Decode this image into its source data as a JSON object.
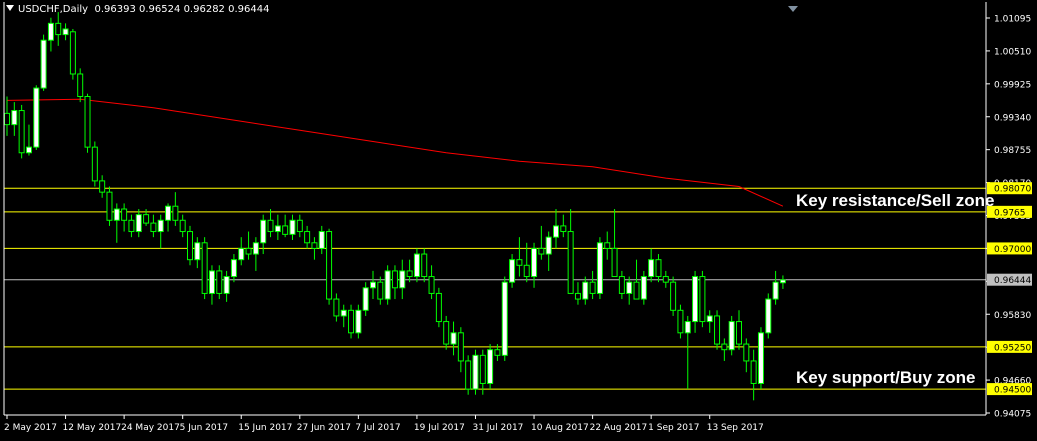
{
  "header": {
    "symbol_timeframe": "USDCHF,Daily",
    "open": "0.96393",
    "high": "0.96524",
    "low": "0.96282",
    "close": "0.96444"
  },
  "annotations": {
    "resistance": "Key resistance/Sell zone",
    "support": "Key support/Buy zone"
  },
  "colors": {
    "background": "#000000",
    "bull_candle": "#ffffff",
    "bear_candle": "#000000",
    "wick": "#00ff00",
    "ma_line": "#ff0000",
    "level_line": "#ffff00",
    "current_line": "#c0c0c0",
    "axis": "#ffffff"
  },
  "chart_data": {
    "type": "candlestick",
    "title": "USDCHF,Daily",
    "ylim": [
      0.94075,
      1.01095
    ],
    "y_ticks": [
      "1.01095",
      "1.00510",
      "0.99925",
      "0.99340",
      "0.98755",
      "0.98170",
      "0.97585",
      "0.97000",
      "0.96415",
      "0.95830",
      "0.95245",
      "0.94660",
      "0.94075"
    ],
    "x_ticks": [
      {
        "date": "2 May 2017",
        "index": 0
      },
      {
        "date": "12 May 2017",
        "index": 8
      },
      {
        "date": "24 May 2017",
        "index": 16
      },
      {
        "date": "5 Jun 2017",
        "index": 24
      },
      {
        "date": "15 Jun 2017",
        "index": 32
      },
      {
        "date": "27 Jun 2017",
        "index": 40
      },
      {
        "date": "7 Jul 2017",
        "index": 48
      },
      {
        "date": "19 Jul 2017",
        "index": 56
      },
      {
        "date": "31 Jul 2017",
        "index": 64
      },
      {
        "date": "10 Aug 2017",
        "index": 72
      },
      {
        "date": "22 Aug 2017",
        "index": 80
      },
      {
        "date": "1 Sep 2017",
        "index": 88
      },
      {
        "date": "13 Sep 2017",
        "index": 96
      }
    ],
    "levels": [
      {
        "value": 0.9807,
        "label": "0.98070"
      },
      {
        "value": 0.9765,
        "label": 0.9765
      },
      {
        "value": 0.97,
        "label": "0.97000"
      },
      {
        "value": 0.9525,
        "label": "0.95250"
      },
      {
        "value": 0.945,
        "label": "0.94500"
      }
    ],
    "current_price": {
      "value": 0.96444,
      "label": "0.96444"
    },
    "candles": [
      [
        0.994,
        0.997,
        0.99,
        0.992
      ],
      [
        0.992,
        0.996,
        0.99,
        0.9945
      ],
      [
        0.9945,
        0.9955,
        0.986,
        0.987
      ],
      [
        0.987,
        0.992,
        0.9865,
        0.988
      ],
      [
        0.988,
        0.999,
        0.9875,
        0.9985
      ],
      [
        0.9985,
        1.008,
        0.998,
        1.007
      ],
      [
        1.007,
        1.011,
        1.005,
        1.01
      ],
      [
        1.01,
        1.012,
        1.006,
        1.008
      ],
      [
        1.008,
        1.01,
        1.007,
        1.009
      ],
      [
        1.0085,
        1.009,
        1.0,
        1.001
      ],
      [
        1.001,
        1.002,
        0.996,
        0.997
      ],
      [
        0.997,
        0.9975,
        0.987,
        0.988
      ],
      [
        0.988,
        0.989,
        0.981,
        0.982
      ],
      [
        0.982,
        0.983,
        0.979,
        0.98
      ],
      [
        0.98,
        0.981,
        0.974,
        0.975
      ],
      [
        0.975,
        0.978,
        0.971,
        0.977
      ],
      [
        0.977,
        0.978,
        0.973,
        0.975
      ],
      [
        0.975,
        0.976,
        0.972,
        0.973
      ],
      [
        0.973,
        0.977,
        0.972,
        0.976
      ],
      [
        0.976,
        0.977,
        0.974,
        0.9745
      ],
      [
        0.9745,
        0.976,
        0.972,
        0.973
      ],
      [
        0.973,
        0.976,
        0.97,
        0.975
      ],
      [
        0.975,
        0.978,
        0.973,
        0.9775
      ],
      [
        0.9775,
        0.98,
        0.974,
        0.975
      ],
      [
        0.975,
        0.976,
        0.972,
        0.973
      ],
      [
        0.973,
        0.974,
        0.967,
        0.968
      ],
      [
        0.968,
        0.972,
        0.9665,
        0.971
      ],
      [
        0.971,
        0.972,
        0.961,
        0.962
      ],
      [
        0.962,
        0.967,
        0.96,
        0.966
      ],
      [
        0.966,
        0.967,
        0.961,
        0.962
      ],
      [
        0.962,
        0.966,
        0.9605,
        0.965
      ],
      [
        0.965,
        0.969,
        0.964,
        0.968
      ],
      [
        0.968,
        0.972,
        0.967,
        0.97
      ],
      [
        0.97,
        0.973,
        0.968,
        0.969
      ],
      [
        0.969,
        0.972,
        0.966,
        0.971
      ],
      [
        0.971,
        0.976,
        0.969,
        0.975
      ],
      [
        0.975,
        0.977,
        0.972,
        0.973
      ],
      [
        0.973,
        0.976,
        0.9715,
        0.974
      ],
      [
        0.974,
        0.976,
        0.972,
        0.9725
      ],
      [
        0.9725,
        0.976,
        0.9715,
        0.975
      ],
      [
        0.975,
        0.976,
        0.972,
        0.973
      ],
      [
        0.973,
        0.974,
        0.97,
        0.971
      ],
      [
        0.971,
        0.972,
        0.968,
        0.97
      ],
      [
        0.97,
        0.974,
        0.969,
        0.973
      ],
      [
        0.973,
        0.9735,
        0.96,
        0.961
      ],
      [
        0.961,
        0.962,
        0.957,
        0.958
      ],
      [
        0.958,
        0.96,
        0.956,
        0.959
      ],
      [
        0.959,
        0.96,
        0.954,
        0.955
      ],
      [
        0.955,
        0.96,
        0.954,
        0.959
      ],
      [
        0.959,
        0.964,
        0.958,
        0.963
      ],
      [
        0.963,
        0.966,
        0.961,
        0.964
      ],
      [
        0.964,
        0.965,
        0.96,
        0.961
      ],
      [
        0.961,
        0.967,
        0.96,
        0.966
      ],
      [
        0.966,
        0.967,
        0.961,
        0.963
      ],
      [
        0.963,
        0.968,
        0.961,
        0.966
      ],
      [
        0.966,
        0.968,
        0.964,
        0.965
      ],
      [
        0.965,
        0.97,
        0.964,
        0.969
      ],
      [
        0.969,
        0.97,
        0.964,
        0.965
      ],
      [
        0.965,
        0.967,
        0.961,
        0.962
      ],
      [
        0.962,
        0.963,
        0.956,
        0.957
      ],
      [
        0.957,
        0.958,
        0.952,
        0.953
      ],
      [
        0.953,
        0.957,
        0.951,
        0.955
      ],
      [
        0.955,
        0.956,
        0.948,
        0.95
      ],
      [
        0.95,
        0.951,
        0.944,
        0.945
      ],
      [
        0.945,
        0.952,
        0.944,
        0.951
      ],
      [
        0.951,
        0.952,
        0.944,
        0.946
      ],
      [
        0.946,
        0.953,
        0.945,
        0.952
      ],
      [
        0.952,
        0.953,
        0.95,
        0.951
      ],
      [
        0.951,
        0.965,
        0.95,
        0.964
      ],
      [
        0.964,
        0.969,
        0.963,
        0.968
      ],
      [
        0.968,
        0.972,
        0.965,
        0.967
      ],
      [
        0.967,
        0.971,
        0.964,
        0.965
      ],
      [
        0.965,
        0.971,
        0.963,
        0.97
      ],
      [
        0.97,
        0.974,
        0.968,
        0.969
      ],
      [
        0.969,
        0.973,
        0.966,
        0.972
      ],
      [
        0.972,
        0.977,
        0.97,
        0.974
      ],
      [
        0.974,
        0.976,
        0.972,
        0.973
      ],
      [
        0.973,
        0.977,
        0.971,
        0.962
      ],
      [
        0.962,
        0.964,
        0.96,
        0.961
      ],
      [
        0.961,
        0.965,
        0.96,
        0.964
      ],
      [
        0.964,
        0.966,
        0.961,
        0.962
      ],
      [
        0.962,
        0.972,
        0.961,
        0.971
      ],
      [
        0.971,
        0.973,
        0.968,
        0.97
      ],
      [
        0.97,
        0.977,
        0.969,
        0.965
      ],
      [
        0.965,
        0.966,
        0.961,
        0.962
      ],
      [
        0.962,
        0.965,
        0.96,
        0.964
      ],
      [
        0.964,
        0.968,
        0.962,
        0.961
      ],
      [
        0.961,
        0.966,
        0.96,
        0.965
      ],
      [
        0.965,
        0.97,
        0.964,
        0.968
      ],
      [
        0.968,
        0.969,
        0.964,
        0.965
      ],
      [
        0.965,
        0.966,
        0.963,
        0.964
      ],
      [
        0.964,
        0.965,
        0.958,
        0.959
      ],
      [
        0.959,
        0.96,
        0.954,
        0.955
      ],
      [
        0.955,
        0.958,
        0.945,
        0.957
      ],
      [
        0.957,
        0.966,
        0.955,
        0.965
      ],
      [
        0.965,
        0.966,
        0.956,
        0.957
      ],
      [
        0.957,
        0.959,
        0.955,
        0.958
      ],
      [
        0.958,
        0.959,
        0.952,
        0.953
      ],
      [
        0.953,
        0.954,
        0.95,
        0.952
      ],
      [
        0.952,
        0.958,
        0.951,
        0.957
      ],
      [
        0.957,
        0.959,
        0.952,
        0.953
      ],
      [
        0.953,
        0.954,
        0.948,
        0.95
      ],
      [
        0.95,
        0.952,
        0.943,
        0.946
      ],
      [
        0.946,
        0.956,
        0.945,
        0.955
      ],
      [
        0.955,
        0.962,
        0.954,
        0.961
      ],
      [
        0.961,
        0.966,
        0.96,
        0.964
      ],
      [
        0.9639,
        0.9652,
        0.9628,
        0.9644
      ]
    ],
    "moving_average": [
      [
        0,
        0.9963
      ],
      [
        10,
        0.9965
      ],
      [
        20,
        0.995
      ],
      [
        30,
        0.993
      ],
      [
        40,
        0.991
      ],
      [
        50,
        0.989
      ],
      [
        60,
        0.987
      ],
      [
        70,
        0.9855
      ],
      [
        80,
        0.9845
      ],
      [
        90,
        0.9825
      ],
      [
        100,
        0.981
      ],
      [
        106,
        0.9775
      ]
    ]
  }
}
